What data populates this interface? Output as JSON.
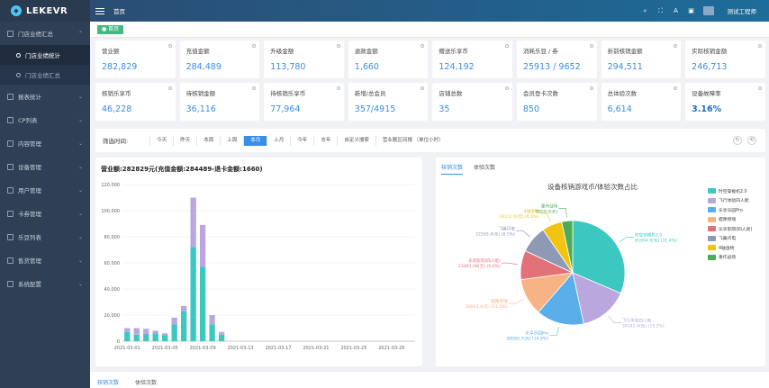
{
  "brand": {
    "name": "LEKEVR"
  },
  "sidebar": {
    "items": [
      {
        "label": "门店业绩汇总",
        "expanded": true
      },
      {
        "label": "门店业绩统计",
        "sub": true,
        "active": true
      },
      {
        "label": "门店业绩汇总",
        "sub": true,
        "active": false
      },
      {
        "label": "报表统计"
      },
      {
        "label": "CP列表"
      },
      {
        "label": "内容管理"
      },
      {
        "label": "设备管理"
      },
      {
        "label": "用户管理"
      },
      {
        "label": "卡券管理"
      },
      {
        "label": "乐豆列表"
      },
      {
        "label": "售货管理"
      },
      {
        "label": "系统配置"
      }
    ]
  },
  "header": {
    "breadcrumb": "首页",
    "user": "测试工程师"
  },
  "tabs": {
    "active_tag": "● 首页"
  },
  "stats_row1": [
    {
      "label": "营业额",
      "value": "282,829"
    },
    {
      "label": "充值金额",
      "value": "284,489"
    },
    {
      "label": "升级金额",
      "value": "113,780"
    },
    {
      "label": "退款金额",
      "value": "1,660"
    },
    {
      "label": "赠送乐享币",
      "value": "124,192"
    },
    {
      "label": "消耗乐豆 / 券",
      "value": "25913 / 9652"
    },
    {
      "label": "折前核销金额",
      "value": "294,511"
    },
    {
      "label": "实际核销金额",
      "value": "246,713"
    }
  ],
  "stats_row2": [
    {
      "label": "核销乐享币",
      "value": "46,228"
    },
    {
      "label": "待核销金额",
      "value": "36,116"
    },
    {
      "label": "待核销乐享币",
      "value": "77,964"
    },
    {
      "label": "新增/总会员",
      "value": "357/4915"
    },
    {
      "label": "店铺总数",
      "value": "35"
    },
    {
      "label": "会员登卡次数",
      "value": "850"
    },
    {
      "label": "总体验次数",
      "value": "6,614"
    },
    {
      "label": "设备故障率",
      "value": "3.16%"
    }
  ],
  "filter": {
    "label": "筛选时间:",
    "options": [
      "今天",
      "昨天",
      "本周",
      "上周",
      "本月",
      "上月",
      "今年",
      "去年",
      "自定义搜索",
      "营业额区间搜 （单位小时）"
    ],
    "active_index": 4
  },
  "bar_panel": {
    "title": "营业额:282829元(充值金额:284489-退卡金额:1660)"
  },
  "pie_panel": {
    "tabs": [
      "核销次数",
      "体验次数"
    ],
    "title": "设备核销游戏币/体验次数占比"
  },
  "bottom_tabs": [
    "核销次数",
    "体验次数"
  ],
  "chart_data": [
    {
      "type": "bar",
      "title": "营业额:282829元(充值金额:284489-退卡金额:1660)",
      "x": [
        "2021-03-01",
        "2021-03-05",
        "2021-03-09",
        "2021-03-13",
        "2021-03-17",
        "2021-03-21",
        "2021-03-25",
        "2021-03-29"
      ],
      "ylim": [
        0,
        120000
      ],
      "yticks": [
        0,
        20000,
        40000,
        60000,
        80000,
        100000,
        120000
      ],
      "grid": true,
      "series": [
        {
          "values": [
            7000,
            5000,
            5500,
            6000,
            4500,
            13000,
            23000,
            72000,
            57000,
            13000,
            5000,
            0,
            0,
            0,
            0,
            0,
            0,
            0,
            0,
            0,
            0,
            0,
            0,
            0,
            0,
            0,
            0,
            0,
            0,
            0,
            0
          ],
          "color": "#3cc7c0"
        },
        {
          "values": [
            3000,
            5000,
            4000,
            2000,
            1500,
            5000,
            4000,
            38000,
            32000,
            7000,
            2000,
            0,
            0,
            0,
            0,
            0,
            0,
            0,
            0,
            0,
            0,
            0,
            0,
            0,
            0,
            0,
            0,
            0,
            0,
            0,
            0
          ],
          "color": "#b9a7dd"
        }
      ]
    },
    {
      "type": "pie",
      "title": "设备核销游戏币/体验次数占比",
      "legend_position": "right",
      "slices": [
        {
          "label": "时空穿梭机2.0",
          "value": 31.4,
          "callout": "81904.0(元) (31.4%)",
          "color": "#3cc7c0"
        },
        {
          "label": "飞行体验四人舱",
          "value": 15.2,
          "callout": "39142.4(元) (15.2%)",
          "color": "#b9a7dd"
        },
        {
          "label": "乐享乐园Pro",
          "value": 14.8,
          "callout": "38580.7(元) (14.8%)",
          "color": "#5aaeea"
        },
        {
          "label": "蜡像惊魂",
          "value": 11.5,
          "callout": "30043.4(元) (11.5%)",
          "color": "#f8b384"
        },
        {
          "label": "乐享影院(四人舱)",
          "value": 9.0,
          "callout": "23461.08(元) (9.0%)",
          "color": "#e2717a"
        },
        {
          "label": "飞翼闪电",
          "value": 8.5,
          "callout": "22265.4(元) (8.5%)",
          "color": "#8e9ab5"
        },
        {
          "label": "4轴蛋椅",
          "value": 6.2,
          "callout": "16157.0(元) (6.2%)",
          "color": "#f2c40e"
        },
        {
          "label": "重作战场",
          "value": 3.4,
          "callout": "8859.0(元)",
          "color": "#4aad56"
        }
      ]
    }
  ]
}
